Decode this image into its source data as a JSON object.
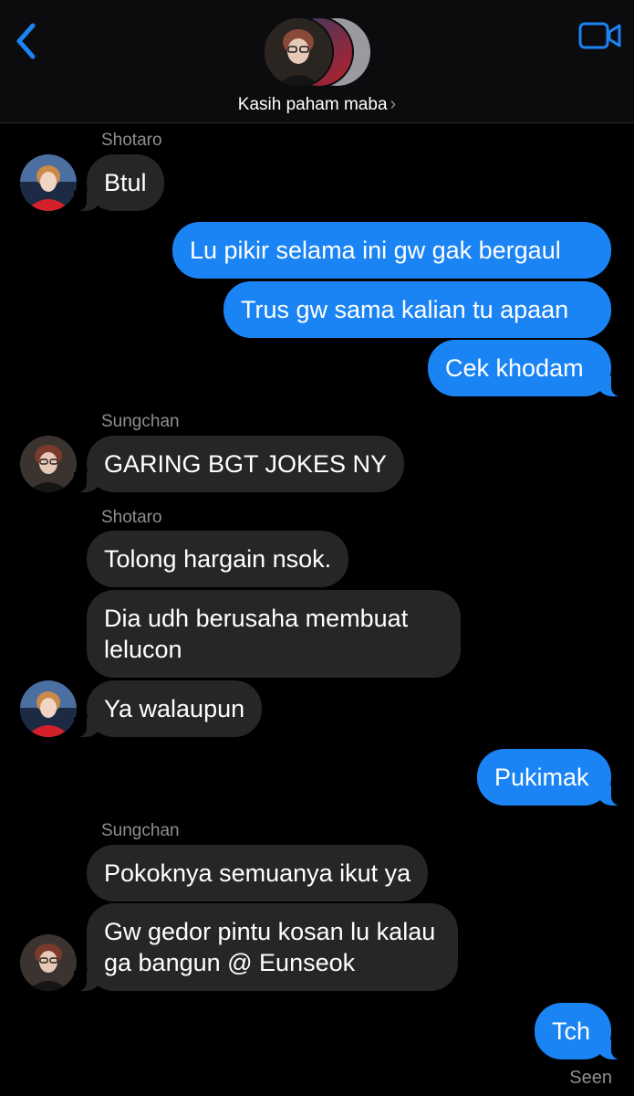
{
  "header": {
    "title": "Kasih paham maba",
    "chevron": "›",
    "back_icon": "chevron-left-icon",
    "video_icon": "video-camera-icon",
    "accent": "#1b84f5"
  },
  "messages": [
    {
      "sender": "Shotaro"
    },
    {
      "text": "Btul"
    },
    {
      "text": "Lu pikir selama ini gw gak bergaul"
    },
    {
      "text": "Trus gw sama kalian tu apaan"
    },
    {
      "text": "Cek khodam"
    },
    {
      "sender": "Sungchan"
    },
    {
      "text": "GARING BGT JOKES NY"
    },
    {
      "sender": "Shotaro"
    },
    {
      "text": "Tolong hargain nsok."
    },
    {
      "text": "Dia udh berusaha membuat lelucon"
    },
    {
      "text": "Ya walaupun"
    },
    {
      "text": "Pukimak"
    },
    {
      "sender": "Sungchan"
    },
    {
      "text": "Pokoknya semuanya ikut ya"
    },
    {
      "text": "Gw gedor pintu kosan lu kalau ga bangun @ Eunseok"
    },
    {
      "text": "Tch"
    }
  ],
  "status": {
    "seen": "Seen"
  }
}
